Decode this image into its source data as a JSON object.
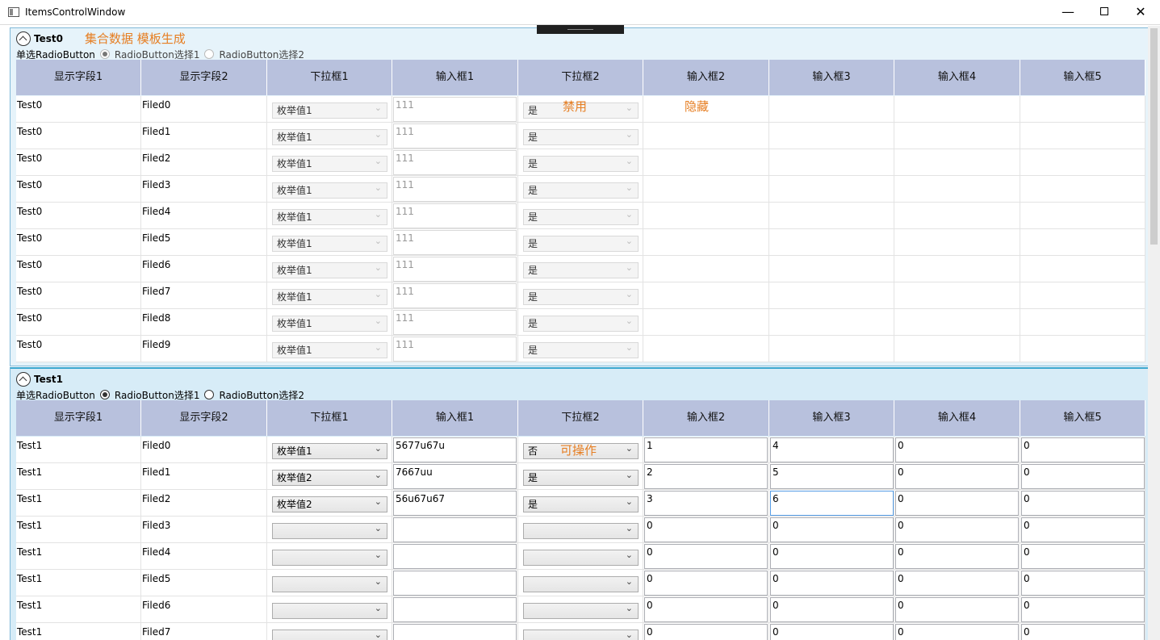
{
  "window": {
    "title": "ItemsControlWindow",
    "minimize": "—",
    "close": "✕"
  },
  "annotations": {
    "collection": "集合数据 模板生成",
    "disabled": "禁用",
    "hidden": "隐藏",
    "operable": "可操作"
  },
  "columns": [
    "显示字段1",
    "显示字段2",
    "下拉框1",
    "输入框1",
    "下拉框2",
    "输入框2",
    "输入框3",
    "输入框4",
    "输入框5"
  ],
  "group0": {
    "name": "Test0",
    "radio_label": "单选RadioButton",
    "radio1": "RadioButton选择1",
    "radio2": "RadioButton选择2",
    "rows": [
      {
        "c1": "Test0",
        "c2": "Filed0",
        "combo1": "枚举值1",
        "input1": "111",
        "combo2": "是"
      },
      {
        "c1": "Test0",
        "c2": "Filed1",
        "combo1": "枚举值1",
        "input1": "111",
        "combo2": "是"
      },
      {
        "c1": "Test0",
        "c2": "Filed2",
        "combo1": "枚举值1",
        "input1": "111",
        "combo2": "是"
      },
      {
        "c1": "Test0",
        "c2": "Filed3",
        "combo1": "枚举值1",
        "input1": "111",
        "combo2": "是"
      },
      {
        "c1": "Test0",
        "c2": "Filed4",
        "combo1": "枚举值1",
        "input1": "111",
        "combo2": "是"
      },
      {
        "c1": "Test0",
        "c2": "Filed5",
        "combo1": "枚举值1",
        "input1": "111",
        "combo2": "是"
      },
      {
        "c1": "Test0",
        "c2": "Filed6",
        "combo1": "枚举值1",
        "input1": "111",
        "combo2": "是"
      },
      {
        "c1": "Test0",
        "c2": "Filed7",
        "combo1": "枚举值1",
        "input1": "111",
        "combo2": "是"
      },
      {
        "c1": "Test0",
        "c2": "Filed8",
        "combo1": "枚举值1",
        "input1": "111",
        "combo2": "是"
      },
      {
        "c1": "Test0",
        "c2": "Filed9",
        "combo1": "枚举值1",
        "input1": "111",
        "combo2": "是"
      }
    ]
  },
  "group1": {
    "name": "Test1",
    "radio_label": "单选RadioButton",
    "radio1": "RadioButton选择1",
    "radio2": "RadioButton选择2",
    "rows": [
      {
        "c1": "Test1",
        "c2": "Filed0",
        "combo1": "枚举值1",
        "input1": "5677u67u",
        "combo2": "否",
        "i2": "1",
        "i3": "4",
        "i4": "0",
        "i5": "0"
      },
      {
        "c1": "Test1",
        "c2": "Filed1",
        "combo1": "枚举值2",
        "input1": "7667uu",
        "combo2": "是",
        "i2": "2",
        "i3": "5",
        "i4": "0",
        "i5": "0"
      },
      {
        "c1": "Test1",
        "c2": "Filed2",
        "combo1": "枚举值2",
        "input1": "56u67u67",
        "combo2": "是",
        "i2": "3",
        "i3": "6",
        "i4": "0",
        "i5": "0"
      },
      {
        "c1": "Test1",
        "c2": "Filed3",
        "combo1": "",
        "input1": "",
        "combo2": "",
        "i2": "0",
        "i3": "0",
        "i4": "0",
        "i5": "0"
      },
      {
        "c1": "Test1",
        "c2": "Filed4",
        "combo1": "",
        "input1": "",
        "combo2": "",
        "i2": "0",
        "i3": "0",
        "i4": "0",
        "i5": "0"
      },
      {
        "c1": "Test1",
        "c2": "Filed5",
        "combo1": "",
        "input1": "",
        "combo2": "",
        "i2": "0",
        "i3": "0",
        "i4": "0",
        "i5": "0"
      },
      {
        "c1": "Test1",
        "c2": "Filed6",
        "combo1": "",
        "input1": "",
        "combo2": "",
        "i2": "0",
        "i3": "0",
        "i4": "0",
        "i5": "0"
      },
      {
        "c1": "Test1",
        "c2": "Filed7",
        "combo1": "",
        "input1": "",
        "combo2": "",
        "i2": "0",
        "i3": "0",
        "i4": "0",
        "i5": "0"
      }
    ]
  }
}
